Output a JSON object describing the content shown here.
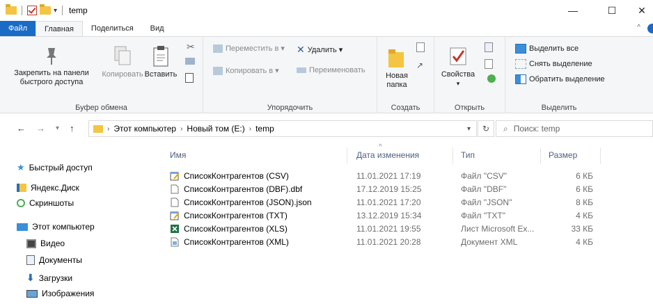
{
  "window": {
    "title": "temp",
    "minimize": "—",
    "maximize": "☐",
    "close": "✕"
  },
  "tabs": [
    "Файл",
    "Главная",
    "Поделиться",
    "Вид"
  ],
  "ribbon": {
    "clipboard": {
      "label": "Буфер обмена",
      "pin": "Закрепить на панели быстрого доступа",
      "copy": "Копировать",
      "paste": "Вставить"
    },
    "organize": {
      "label": "Упорядочить",
      "move_to": "Переместить в ▾",
      "copy_to": "Копировать в ▾",
      "delete": "Удалить ▾",
      "rename": "Переименовать"
    },
    "new": {
      "label": "Создать",
      "new_folder": "Новая папка"
    },
    "open": {
      "label": "Открыть",
      "properties": "Свойства"
    },
    "select": {
      "label": "Выделить",
      "select_all": "Выделить все",
      "select_none": "Снять выделение",
      "invert": "Обратить выделение"
    }
  },
  "address": {
    "crumbs": [
      "Этот компьютер",
      "Новый том (E:)",
      "temp"
    ],
    "search_placeholder": "Поиск: temp"
  },
  "nav": {
    "quick_access": "Быстрый доступ",
    "yadisk": "Яндекс.Диск",
    "screenshots": "Скриншоты",
    "this_pc": "Этот компьютер",
    "video": "Видео",
    "documents": "Документы",
    "downloads": "Загрузки",
    "images": "Изображения"
  },
  "columns": {
    "name": "Имя",
    "date": "Дата изменения",
    "type": "Тип",
    "size": "Размер"
  },
  "files": [
    {
      "name": "СписокКонтрагентов (CSV)",
      "date": "11.01.2021 17:19",
      "type": "Файл \"CSV\"",
      "size": "6 КБ",
      "icon": "notepad-icon"
    },
    {
      "name": "СписокКонтрагентов (DBF).dbf",
      "date": "17.12.2019 15:25",
      "type": "Файл \"DBF\"",
      "size": "6 КБ",
      "icon": "blank-file-icon"
    },
    {
      "name": "СписокКонтрагентов (JSON).json",
      "date": "11.01.2021 17:20",
      "type": "Файл \"JSON\"",
      "size": "8 КБ",
      "icon": "blank-file-icon"
    },
    {
      "name": "СписокКонтрагентов (TXT)",
      "date": "13.12.2019 15:34",
      "type": "Файл \"TXT\"",
      "size": "4 КБ",
      "icon": "notepad-icon"
    },
    {
      "name": "СписокКонтрагентов (XLS)",
      "date": "11.01.2021 19:55",
      "type": "Лист Microsoft Ex...",
      "size": "33 КБ",
      "icon": "excel-icon"
    },
    {
      "name": "СписокКонтрагентов (XML)",
      "date": "11.01.2021 20:28",
      "type": "Документ XML",
      "size": "4 КБ",
      "icon": "xml-icon"
    }
  ]
}
